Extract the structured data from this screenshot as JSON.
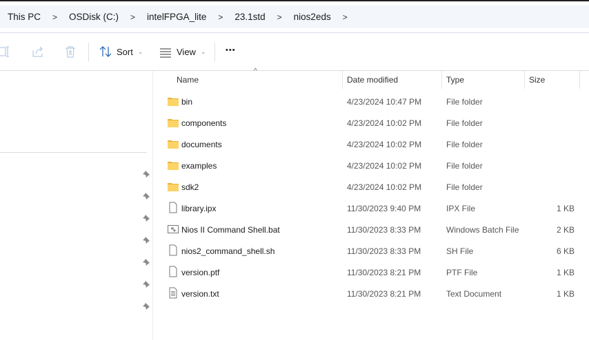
{
  "breadcrumb": [
    "This PC",
    "OSDisk (C:)",
    "intelFPGA_lite",
    "23.1std",
    "nios2eds"
  ],
  "toolbar": {
    "sort": "Sort",
    "view": "View",
    "more": "•••"
  },
  "columns": {
    "name": "Name",
    "date": "Date modified",
    "type": "Type",
    "size": "Size"
  },
  "files": [
    {
      "name": "bin",
      "date": "4/23/2024 10:47 PM",
      "type": "File folder",
      "size": "",
      "icon": "folder"
    },
    {
      "name": "components",
      "date": "4/23/2024 10:02 PM",
      "type": "File folder",
      "size": "",
      "icon": "folder"
    },
    {
      "name": "documents",
      "date": "4/23/2024 10:02 PM",
      "type": "File folder",
      "size": "",
      "icon": "folder"
    },
    {
      "name": "examples",
      "date": "4/23/2024 10:02 PM",
      "type": "File folder",
      "size": "",
      "icon": "folder"
    },
    {
      "name": "sdk2",
      "date": "4/23/2024 10:02 PM",
      "type": "File folder",
      "size": "",
      "icon": "folder"
    },
    {
      "name": "library.ipx",
      "date": "11/30/2023 9:40 PM",
      "type": "IPX File",
      "size": "1 KB",
      "icon": "file"
    },
    {
      "name": "Nios II Command Shell.bat",
      "date": "11/30/2023 8:33 PM",
      "type": "Windows Batch File",
      "size": "2 KB",
      "icon": "batch"
    },
    {
      "name": "nios2_command_shell.sh",
      "date": "11/30/2023 8:33 PM",
      "type": "SH File",
      "size": "6 KB",
      "icon": "file"
    },
    {
      "name": "version.ptf",
      "date": "11/30/2023 8:21 PM",
      "type": "PTF File",
      "size": "1 KB",
      "icon": "file"
    },
    {
      "name": "version.txt",
      "date": "11/30/2023 8:21 PM",
      "type": "Text Document",
      "size": "1 KB",
      "icon": "text"
    }
  ]
}
